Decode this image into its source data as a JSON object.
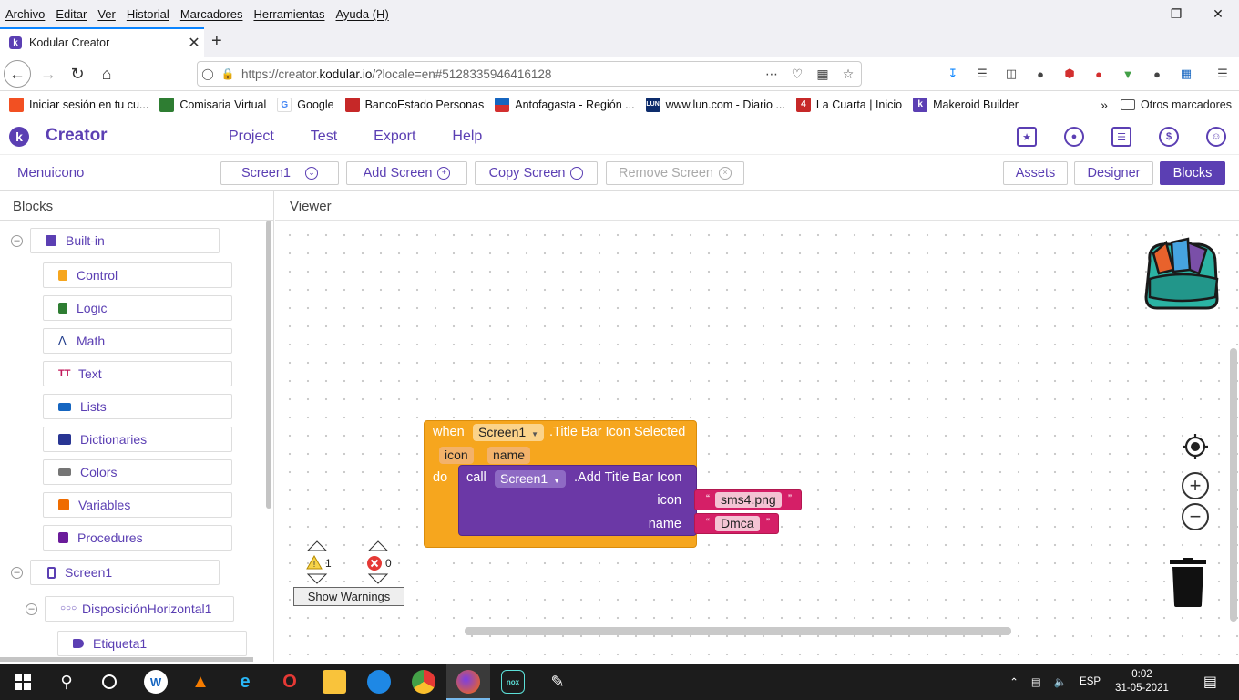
{
  "browser": {
    "menu": [
      "Archivo",
      "Editar",
      "Ver",
      "Historial",
      "Marcadores",
      "Herramientas",
      "Ayuda (H)"
    ],
    "tab_title": "Kodular Creator",
    "url_prefix": "https://creator.",
    "url_domain": "kodular.io",
    "url_suffix": "/?locale=en#5128335946416128",
    "bookmarks": [
      {
        "label": "Iniciar sesión en tu cu...",
        "icon": "microsoft-icon",
        "color": "#f25022"
      },
      {
        "label": "Comisaria Virtual",
        "icon": "police-badge-icon",
        "color": "#2e7d32"
      },
      {
        "label": "Google",
        "icon": "google-icon",
        "color": "#4285f4"
      },
      {
        "label": "BancoEstado Personas",
        "icon": "bank-icon",
        "color": "#c62828"
      },
      {
        "label": "Antofagasta - Región ...",
        "icon": "chile-flag-icon",
        "color": "#d32f2f"
      },
      {
        "label": "www.lun.com - Diario ...",
        "icon": "lun-icon",
        "color": "#0d2c6c"
      },
      {
        "label": "La Cuarta | Inicio",
        "icon": "lacuarta-icon",
        "color": "#c62828"
      },
      {
        "label": "Makeroid Builder",
        "icon": "kodular-icon",
        "color": "#5b3fb3"
      }
    ],
    "other_bookmarks": "Otros marcadores"
  },
  "app": {
    "brand": "Creator",
    "nav": [
      "Project",
      "Test",
      "Export",
      "Help"
    ],
    "project_name": "Menuicono",
    "screen_select": "Screen1",
    "add_screen": "Add Screen",
    "copy_screen": "Copy Screen",
    "remove_screen": "Remove Screen",
    "assets": "Assets",
    "designer": "Designer",
    "blocks": "Blocks",
    "accent": "#5b3fb3"
  },
  "blocks_panel": {
    "title": "Blocks",
    "builtin_label": "Built-in",
    "builtin": [
      {
        "label": "Control",
        "color": "#f6a61e"
      },
      {
        "label": "Logic",
        "color": "#2e7d32"
      },
      {
        "label": "Math",
        "color": "#1e3a8a"
      },
      {
        "label": "Text",
        "color": "#c2185b"
      },
      {
        "label": "Lists",
        "color": "#1565c0"
      },
      {
        "label": "Dictionaries",
        "color": "#283593"
      },
      {
        "label": "Colors",
        "color": "#757575"
      },
      {
        "label": "Variables",
        "color": "#ef6c00"
      },
      {
        "label": "Procedures",
        "color": "#6a1b9a"
      }
    ],
    "screen": "Screen1",
    "arrangement": "DisposiciónHorizontal1",
    "label": "Etiqueta1"
  },
  "viewer": {
    "title": "Viewer",
    "event": {
      "when": "when",
      "component": "Screen1",
      "event_name": ".Title Bar Icon Selected",
      "params": [
        "icon",
        "name"
      ],
      "do": "do"
    },
    "call": {
      "call": "call",
      "component": "Screen1",
      "method": ".Add Title Bar Icon",
      "arg1_label": "icon",
      "arg1_value": "sms4.png",
      "arg2_label": "name",
      "arg2_value": "Dmca"
    },
    "warnings_count": "1",
    "errors_count": "0",
    "show_warnings": "Show Warnings"
  },
  "taskbar": {
    "lang": "ESP",
    "time": "0:02",
    "date": "31-05-2021"
  }
}
